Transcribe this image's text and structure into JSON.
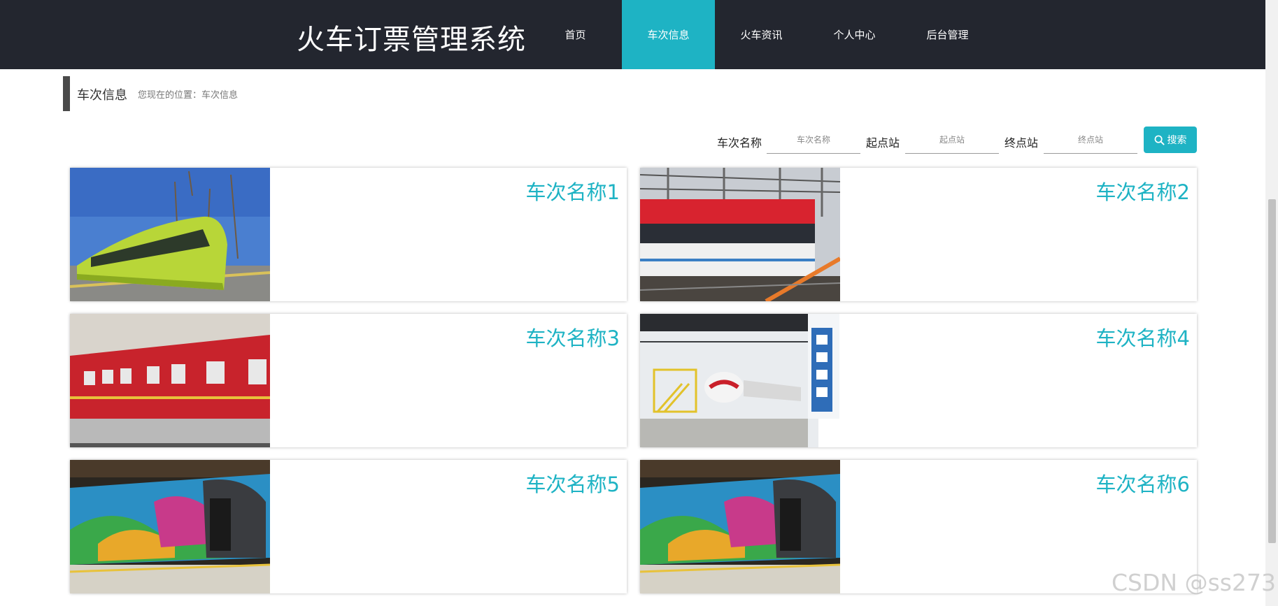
{
  "header": {
    "site_title": "火车订票管理系统",
    "nav": [
      {
        "label": "首页",
        "active": false
      },
      {
        "label": "车次信息",
        "active": true
      },
      {
        "label": "火车资讯",
        "active": false
      },
      {
        "label": "个人中心",
        "active": false
      },
      {
        "label": "后台管理",
        "active": false
      }
    ]
  },
  "breadcrumb": {
    "title": "车次信息",
    "path": "您现在的位置：车次信息"
  },
  "search": {
    "name_label": "车次名称",
    "name_placeholder": "车次名称",
    "start_label": "起点站",
    "start_placeholder": "起点站",
    "end_label": "终点站",
    "end_placeholder": "终点站",
    "button_label": "搜索"
  },
  "trains": [
    {
      "title": "车次名称1",
      "image": "green-tram-photo"
    },
    {
      "title": "车次名称2",
      "image": "red-white-train-photo"
    },
    {
      "title": "车次名称3",
      "image": "red-passenger-car-photo"
    },
    {
      "title": "车次名称4",
      "image": "metro-depot-photo"
    },
    {
      "title": "车次名称5",
      "image": "colorful-metro-photo"
    },
    {
      "title": "车次名称6",
      "image": "colorful-metro-photo"
    }
  ],
  "watermark": "CSDN @ss273",
  "colors": {
    "header_bg": "#23262f",
    "accent": "#1eb3c4"
  }
}
